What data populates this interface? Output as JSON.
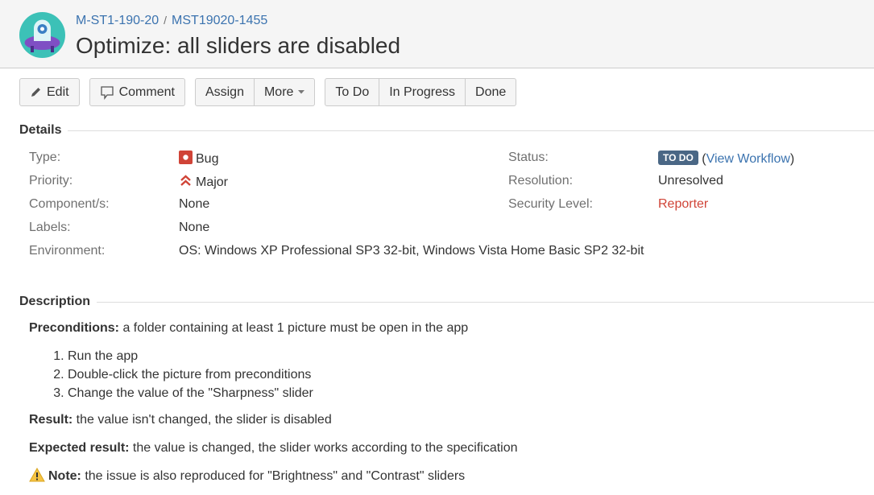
{
  "header": {
    "breadcrumb": [
      "M-ST1-190-20",
      "MST19020-1455"
    ],
    "breadcrumb_sep": "/",
    "title": "Optimize: all sliders are disabled"
  },
  "toolbar": {
    "edit": "Edit",
    "comment": "Comment",
    "assign": "Assign",
    "more": "More",
    "todo": "To Do",
    "in_progress": "In Progress",
    "done": "Done"
  },
  "details": {
    "heading": "Details",
    "type_label": "Type:",
    "type": "Bug",
    "priority_label": "Priority:",
    "priority": "Major",
    "components_label": "Component/s:",
    "components": "None",
    "labels_label": "Labels:",
    "labels": "None",
    "environment_label": "Environment:",
    "environment": "OS: Windows XP Professional SP3 32-bit, Windows Vista Home Basic SP2 32-bit",
    "status_label": "Status:",
    "status": "TO DO",
    "view_workflow": "View Workflow",
    "resolution_label": "Resolution:",
    "resolution": "Unresolved",
    "security_label": "Security Level:",
    "security": "Reporter"
  },
  "description": {
    "heading": "Description",
    "preconditions_label": "Preconditions:",
    "preconditions": " a folder containing at least 1 picture must be open in the app",
    "steps": [
      "Run the app",
      "Double-click the picture from preconditions",
      "Change the value of the \"Sharpness\" slider"
    ],
    "result_label": "Result:",
    "result": " the value isn't changed, the slider is disabled",
    "expected_label": "Expected result:",
    "expected": " the value is changed, the slider works according to the specification",
    "note_label": "Note:",
    "note": " the issue is also reproduced for \"Brightness\" and \"Contrast\" sliders"
  },
  "colors": {
    "link": "#3b73af",
    "status_badge": "#4a6785",
    "bug": "#d04437",
    "priority": "#d04437"
  }
}
